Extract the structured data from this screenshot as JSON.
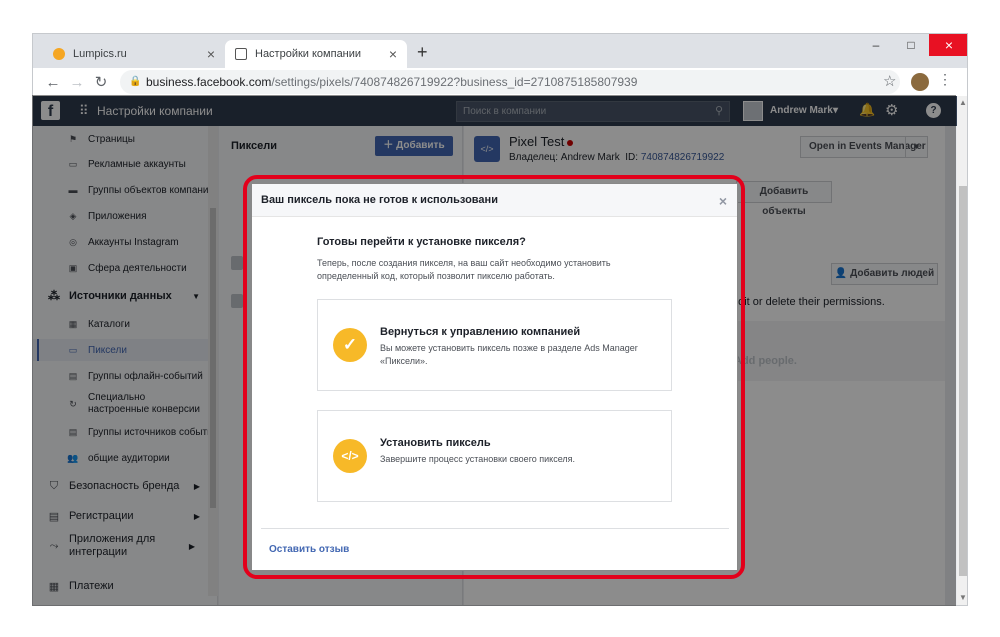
{
  "browser": {
    "tabs": [
      {
        "label": "Lumpics.ru",
        "close": "×"
      },
      {
        "label": "Настройки компании",
        "close": "×"
      }
    ],
    "new_tab": "+",
    "window_controls": {
      "minimize": "–",
      "maximize": "□",
      "close": "×"
    },
    "url_host": "business.facebook.com",
    "url_path": "/settings/pixels/740874826719922?business_id=2710875185807939"
  },
  "fb_header": {
    "logo": "f",
    "title": "Настройки компании",
    "search_placeholder": "Поиск в компании",
    "user_name": "Andrew Mark"
  },
  "sidebar": {
    "items": [
      {
        "label": "Страницы",
        "icon": "flag-icon"
      },
      {
        "label": "Рекламные аккаунты",
        "icon": "ad-account-icon"
      },
      {
        "label": "Группы объектов компании",
        "icon": "folder-icon"
      },
      {
        "label": "Приложения",
        "icon": "cube-icon"
      },
      {
        "label": "Аккаунты Instagram",
        "icon": "instagram-icon"
      },
      {
        "label": "Сфера деятельности",
        "icon": "briefcase-icon"
      },
      {
        "label": "Источники данных",
        "icon": "data-sources-icon"
      },
      {
        "label": "Каталоги",
        "icon": "grid-icon"
      },
      {
        "label": "Пиксели",
        "icon": "pixel-icon"
      },
      {
        "label": "Группы офлайн-событий",
        "icon": "store-icon"
      },
      {
        "label": "Специально настроенные конверсии",
        "icon": "conversion-icon"
      },
      {
        "label": "Группы источников событий",
        "icon": "event-source-icon"
      },
      {
        "label": "общие аудитории",
        "icon": "people-icon"
      },
      {
        "label": "Безопасность бренда",
        "icon": "shield-icon"
      },
      {
        "label": "Регистрации",
        "icon": "register-icon"
      },
      {
        "label": "Приложения для интеграции",
        "icon": "integration-icon"
      },
      {
        "label": "Платежи",
        "icon": "payments-icon"
      }
    ]
  },
  "pixels_panel": {
    "title": "Пиксели",
    "add_button": "Добавить"
  },
  "pixel_details": {
    "name": "Pixel Test",
    "owner_label": "Владелец: Andrew Mark",
    "id_label": "ID:",
    "id_value": "740874826719922",
    "open_events_manager": "Open in Events Manager",
    "add_objects": "Добавить объекты",
    "add_people": "Добавить людей",
    "edit_text": "edit or delete their permissions.",
    "add_people_hint": "Add people."
  },
  "modal": {
    "header": "Ваш пиксель пока не готов к использовани",
    "close": "×",
    "title": "Готовы перейти к установке пикселя?",
    "description": "Теперь, после создания пикселя, на ваш сайт необходимо установить определенный код, который позволит пикселю работать.",
    "option1_title": "Вернуться к управлению компанией",
    "option1_desc": "Вы можете установить пиксель позже в разделе Ads Manager «Пиксели».",
    "option2_title": "Установить пиксель",
    "option2_desc": "Завершите процесс установки своего пикселя.",
    "feedback": "Оставить отзыв"
  },
  "colors": {
    "fb_blue": "#4267b2",
    "header_bg": "#2f3b4e",
    "accent_yellow": "#f7b928",
    "highlight_red": "#e3001b"
  }
}
